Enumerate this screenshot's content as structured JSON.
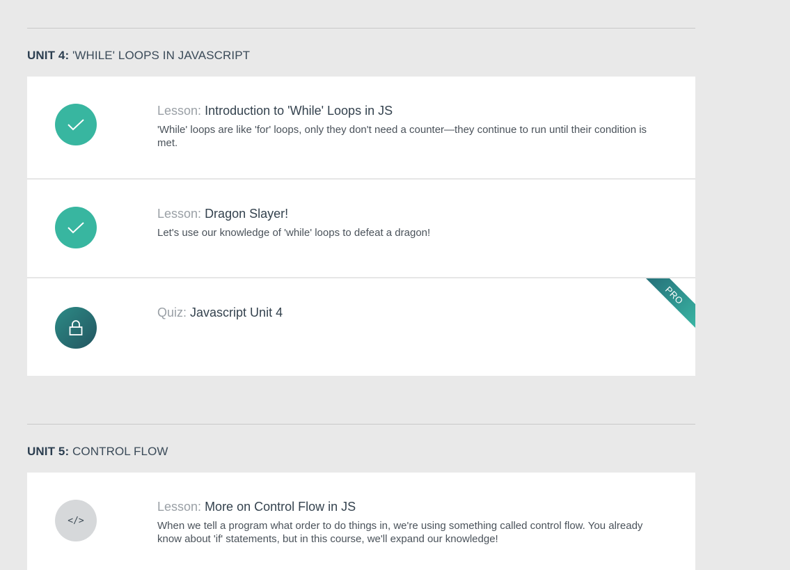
{
  "units": [
    {
      "label": "UNIT 4:",
      "title": "'WHILE' LOOPS IN JAVASCRIPT",
      "items": [
        {
          "kind": "Lesson:",
          "name": "Introduction to 'While' Loops in JS",
          "description": "'While' loops are like 'for' loops, only they don't need a counter—they continue to run until their condition is met.",
          "status": "completed",
          "icon": "check-icon"
        },
        {
          "kind": "Lesson:",
          "name": "Dragon Slayer!",
          "description": "Let's use our knowledge of 'while' loops to defeat a dragon!",
          "status": "completed",
          "icon": "check-icon"
        },
        {
          "kind": "Quiz:",
          "name": "Javascript Unit 4",
          "description": "",
          "status": "locked",
          "icon": "lock-icon",
          "ribbon": "PRO"
        }
      ]
    },
    {
      "label": "UNIT 5:",
      "title": "CONTROL FLOW",
      "items": [
        {
          "kind": "Lesson:",
          "name": "More on Control Flow in JS",
          "description": "When we tell a program what order to do things in, we're using something called control flow. You already know about 'if' statements, but in this course, we'll expand our knowledge!",
          "status": "not-started",
          "icon": "code-icon",
          "icon_text": "</>"
        }
      ]
    }
  ],
  "colors": {
    "page_background": "#e9e9e9",
    "completed": "#38b6a0",
    "locked_start": "#2c8b86",
    "locked_end": "#235560",
    "not_started": "#d6d8da"
  }
}
